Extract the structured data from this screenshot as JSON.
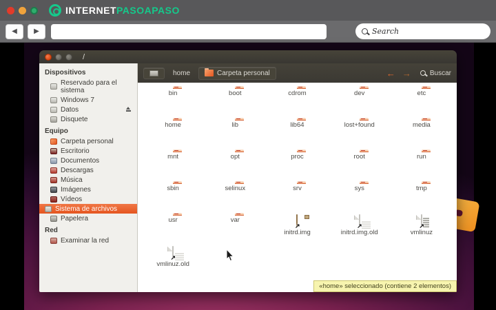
{
  "browser": {
    "logo": {
      "part_white": "INTERNET",
      "part_green": "PASOAPASO"
    },
    "back_glyph": "◀",
    "forward_glyph": "▶",
    "url_value": "",
    "search": {
      "placeholder_text": "Search"
    }
  },
  "desktop_window": {
    "title": "/",
    "pathbar": {
      "home_label": "home",
      "current_label": "Carpeta personal",
      "back_glyph": "←",
      "forward_glyph": "→",
      "search_label": "Buscar"
    },
    "sidebar": {
      "sections": [
        {
          "header": "Dispositivos",
          "items": [
            {
              "label": "Reservado para el sistema",
              "icon": "drive",
              "selected": false,
              "eject": false
            },
            {
              "label": "Windows 7",
              "icon": "drive",
              "selected": false,
              "eject": false
            },
            {
              "label": "Datos",
              "icon": "drive",
              "selected": false,
              "eject": true
            },
            {
              "label": "Disquete",
              "icon": "floppy",
              "selected": false,
              "eject": false
            }
          ]
        },
        {
          "header": "Equipo",
          "items": [
            {
              "label": "Carpeta personal",
              "icon": "folder-o",
              "selected": false,
              "eject": false
            },
            {
              "label": "Escritorio",
              "icon": "desktop-i",
              "selected": false,
              "eject": false
            },
            {
              "label": "Documentos",
              "icon": "docs",
              "selected": false,
              "eject": false
            },
            {
              "label": "Descargas",
              "icon": "downloads",
              "selected": false,
              "eject": false
            },
            {
              "label": "Música",
              "icon": "music",
              "selected": false,
              "eject": false
            },
            {
              "label": "Imágenes",
              "icon": "pictures",
              "selected": false,
              "eject": false
            },
            {
              "label": "Vídeos",
              "icon": "videos",
              "selected": false,
              "eject": false
            },
            {
              "label": "Sistema de archivos",
              "icon": "drive",
              "selected": true,
              "eject": false
            },
            {
              "label": "Papelera",
              "icon": "trash",
              "selected": false,
              "eject": false
            }
          ]
        },
        {
          "header": "Red",
          "items": [
            {
              "label": "Examinar la red",
              "icon": "network",
              "selected": false,
              "eject": false
            }
          ]
        }
      ]
    },
    "files": [
      {
        "label": "bin",
        "kind": "folder",
        "link": false
      },
      {
        "label": "boot",
        "kind": "folder",
        "link": false
      },
      {
        "label": "cdrom",
        "kind": "folder",
        "link": false
      },
      {
        "label": "dev",
        "kind": "folder",
        "link": false
      },
      {
        "label": "etc",
        "kind": "folder",
        "link": false
      },
      {
        "label": "home",
        "kind": "folder",
        "link": false
      },
      {
        "label": "lib",
        "kind": "folder",
        "link": false
      },
      {
        "label": "lib64",
        "kind": "folder",
        "link": false
      },
      {
        "label": "lost+found",
        "kind": "folder",
        "link": false
      },
      {
        "label": "media",
        "kind": "folder",
        "link": false
      },
      {
        "label": "mnt",
        "kind": "folder",
        "link": false
      },
      {
        "label": "opt",
        "kind": "folder",
        "link": false
      },
      {
        "label": "proc",
        "kind": "folder",
        "link": false
      },
      {
        "label": "root",
        "kind": "folder",
        "link": false
      },
      {
        "label": "run",
        "kind": "folder",
        "link": false
      },
      {
        "label": "sbin",
        "kind": "folder",
        "link": false
      },
      {
        "label": "selinux",
        "kind": "folder",
        "link": false
      },
      {
        "label": "srv",
        "kind": "folder",
        "link": false
      },
      {
        "label": "sys",
        "kind": "folder",
        "link": false
      },
      {
        "label": "tmp",
        "kind": "folder",
        "link": false
      },
      {
        "label": "usr",
        "kind": "folder",
        "link": false
      },
      {
        "label": "var",
        "kind": "folder",
        "link": false
      },
      {
        "label": "initrd.img",
        "kind": "package",
        "link": true
      },
      {
        "label": "initrd.img.old",
        "kind": "document",
        "link": true
      },
      {
        "label": "vmlinuz",
        "kind": "textdoc",
        "link": true
      },
      {
        "label": "vmlinuz.old",
        "kind": "document",
        "link": true
      }
    ],
    "statusbar_text": "«home» seleccionado (contiene 2 elementos)",
    "link_emblem_glyph": "↗"
  },
  "colors": {
    "accent_orange": "#E5551F",
    "logo_green": "#15C98B",
    "wallpaper_purple": "#7C2250",
    "tooltip_yellow": "#F7F4AF",
    "titlebar_dark": "#3B3933"
  }
}
